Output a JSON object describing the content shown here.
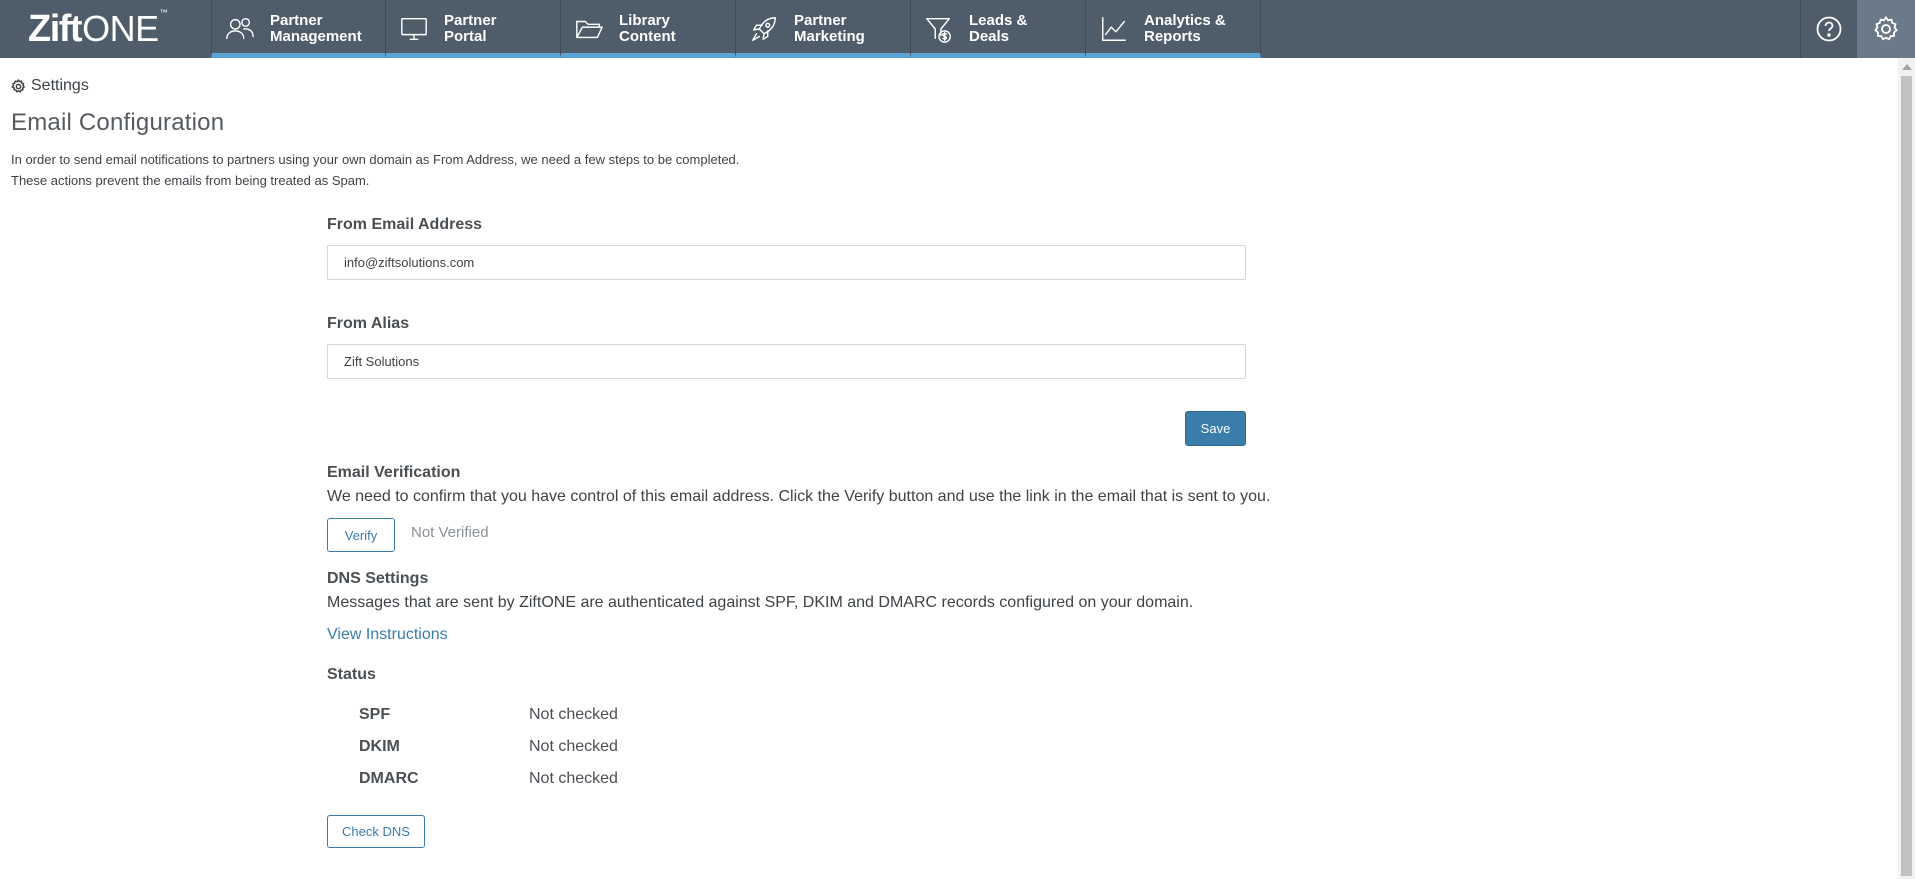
{
  "app": {
    "logo_main": "Zift",
    "logo_sub": "ONE",
    "logo_tm": "™"
  },
  "nav": {
    "items": [
      {
        "line1": "Partner",
        "line2": "Management",
        "icon": "people-icon"
      },
      {
        "line1": "Partner",
        "line2": "Portal",
        "icon": "monitor-icon"
      },
      {
        "line1": "Library",
        "line2": "Content",
        "icon": "folder-icon"
      },
      {
        "line1": "Partner",
        "line2": "Marketing",
        "icon": "rocket-icon"
      },
      {
        "line1": "Leads &",
        "line2": "Deals",
        "icon": "funnel-dollar-icon"
      },
      {
        "line1": "Analytics &",
        "line2": "Reports",
        "icon": "line-chart-icon"
      }
    ],
    "right_icons": [
      "help-icon",
      "gear-icon"
    ]
  },
  "breadcrumb": {
    "label": "Settings"
  },
  "page": {
    "title": "Email Configuration",
    "intro_line1": "In order to send email notifications to partners using your own domain as From Address, we need a few steps to be completed.",
    "intro_line2": "These actions prevent the emails from being treated as Spam."
  },
  "form": {
    "from_email_label": "From Email Address",
    "from_email_value": "info@ziftsolutions.com",
    "from_alias_label": "From Alias",
    "from_alias_value": "Zift Solutions",
    "save_label": "Save"
  },
  "verification": {
    "title": "Email Verification",
    "text": "We need to confirm that you have control of this email address. Click the Verify button and use the link in the email that is sent to you.",
    "verify_label": "Verify",
    "status": "Not Verified"
  },
  "dns": {
    "title": "DNS Settings",
    "text": "Messages that are sent by ZiftONE are authenticated against SPF, DKIM and DMARC records configured on your domain.",
    "link": "View Instructions"
  },
  "status": {
    "title": "Status",
    "rows": [
      {
        "name": "SPF",
        "value": "Not checked"
      },
      {
        "name": "DKIM",
        "value": "Not checked"
      },
      {
        "name": "DMARC",
        "value": "Not checked"
      }
    ],
    "check_label": "Check DNS"
  }
}
